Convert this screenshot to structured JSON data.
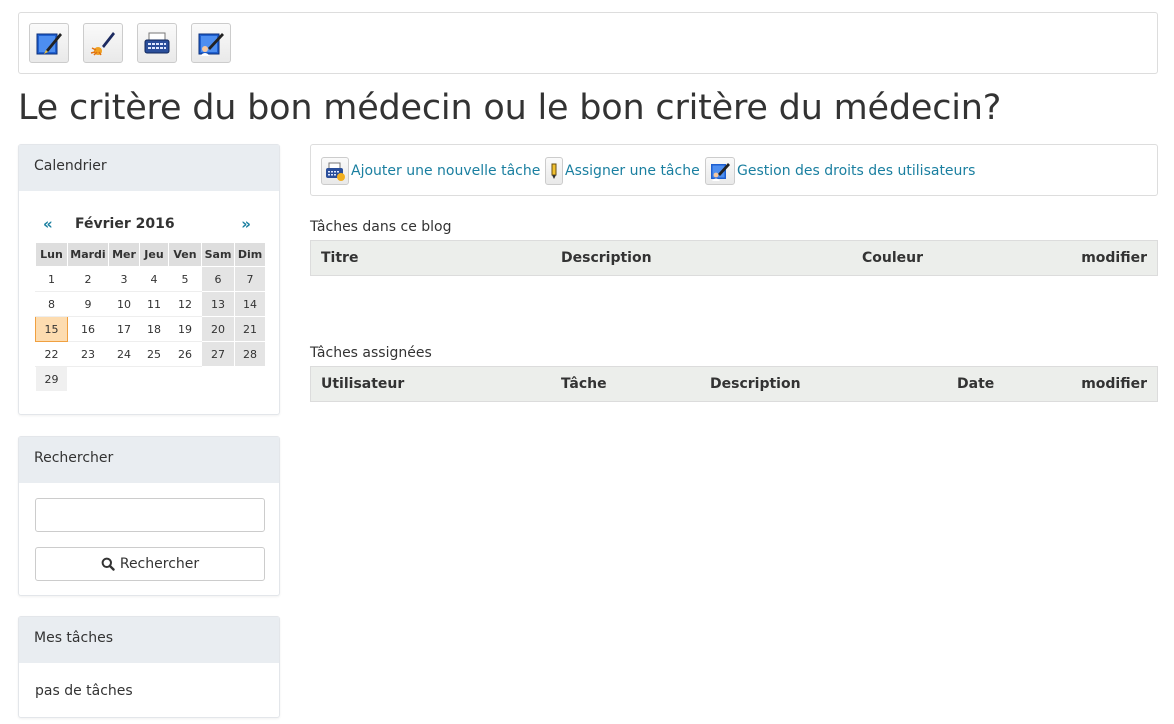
{
  "toolbar": {
    "buttons": [
      {
        "icon": "edit-post-icon"
      },
      {
        "icon": "customize-brush-icon"
      },
      {
        "icon": "typewriter-icon"
      },
      {
        "icon": "user-rights-icon"
      }
    ]
  },
  "page": {
    "title": "Le critère du bon médecin ou le bon critère du médecin?"
  },
  "calendar": {
    "heading": "Calendrier",
    "prev": "«",
    "next": "»",
    "month": "Février 2016",
    "weekdays": [
      "Lun",
      "Mardi",
      "Mer",
      "Jeu",
      "Ven",
      "Sam",
      "Dim"
    ],
    "weeks": [
      [
        "1",
        "2",
        "3",
        "4",
        "5",
        "6",
        "7"
      ],
      [
        "8",
        "9",
        "10",
        "11",
        "12",
        "13",
        "14"
      ],
      [
        "15",
        "16",
        "17",
        "18",
        "19",
        "20",
        "21"
      ],
      [
        "22",
        "23",
        "24",
        "25",
        "26",
        "27",
        "28"
      ],
      [
        "29"
      ]
    ],
    "today": "15"
  },
  "search": {
    "heading": "Rechercher",
    "placeholder": "",
    "button_label": "Rechercher"
  },
  "my_tasks": {
    "heading": "Mes tâches",
    "empty": "pas de tâches"
  },
  "actions": {
    "add_task": "Ajouter une nouvelle tâche",
    "assign_task": "Assigner une tâche",
    "user_rights": "Gestion des droits des utilisateurs"
  },
  "blog_tasks": {
    "label": "Tâches dans ce blog",
    "columns": [
      "Titre",
      "Description",
      "Couleur",
      "modifier"
    ]
  },
  "assigned_tasks": {
    "label": "Tâches assignées",
    "columns": [
      "Utilisateur",
      "Tâche",
      "Description",
      "Date",
      "modifier"
    ]
  },
  "colors": {
    "link": "#1a7fa0",
    "panel_header": "#e9edf1",
    "today": "#fddcb0"
  }
}
